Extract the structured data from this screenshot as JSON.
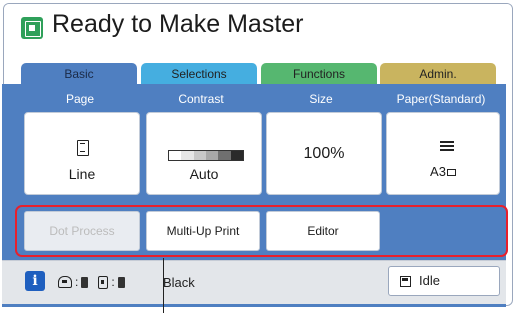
{
  "title": "Ready to Make Master",
  "tabs": [
    "Basic",
    "Selections",
    "Functions",
    "Admin."
  ],
  "columns": [
    {
      "header": "Page",
      "value": "Line",
      "icon": "document-icon"
    },
    {
      "header": "Contrast",
      "value": "Auto",
      "icon": "contrast-scale-icon"
    },
    {
      "header": "Size",
      "value": "100%"
    },
    {
      "header": "Paper(Standard)",
      "value": "A3",
      "icon": "paper-tray-icon"
    }
  ],
  "functions": [
    {
      "label": "Dot Process",
      "enabled": false
    },
    {
      "label": "Multi-Up Print",
      "enabled": true
    },
    {
      "label": "Editor",
      "enabled": true
    }
  ],
  "status": {
    "ink_color": "Black",
    "idle_label": "Idle"
  },
  "colors": {
    "tab_basic": "#4f7fc1",
    "tab_selections": "#45aee0",
    "tab_functions": "#56b770",
    "tab_admin": "#c9b45f",
    "highlight": "#e8202c",
    "info": "#1f5fbf"
  }
}
